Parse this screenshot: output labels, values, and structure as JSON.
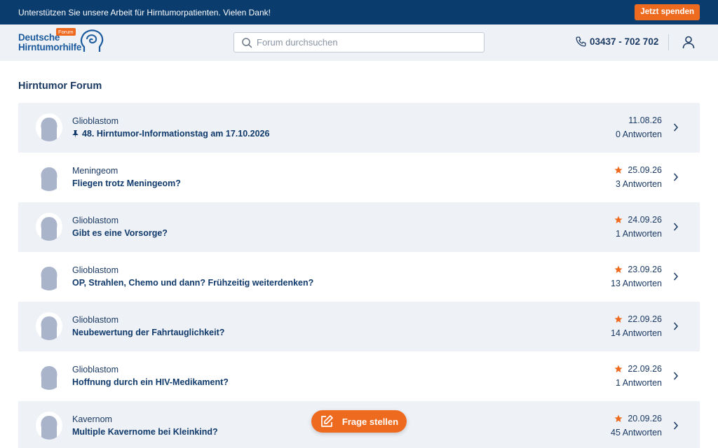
{
  "topbar": {
    "message": "Unterstützen Sie unsere Arbeit für Hirntumorpatienten. Vielen Dank!",
    "donate_label": "Jetzt spenden"
  },
  "header": {
    "logo_line1": "Deutsche",
    "logo_line2": "Hirntumorhilfe",
    "logo_badge": "Forum",
    "search_placeholder": "Forum durchsuchen",
    "phone": "03437 - 702 702"
  },
  "page": {
    "title": "Hirntumor Forum"
  },
  "threads": [
    {
      "category": "Glioblastom",
      "title": "48. Hirntumor-Informationstag am 17.10.2026",
      "date": "11.08.26",
      "replies": "0 Antworten",
      "pinned": true,
      "starred": false
    },
    {
      "category": "Meningeom",
      "title": "Fliegen trotz Meningeom?",
      "date": "25.09.26",
      "replies": "3 Antworten",
      "pinned": false,
      "starred": true
    },
    {
      "category": "Glioblastom",
      "title": "Gibt es eine Vorsorge?",
      "date": "24.09.26",
      "replies": "1 Antworten",
      "pinned": false,
      "starred": true
    },
    {
      "category": "Glioblastom",
      "title": "OP, Strahlen, Chemo und dann? Frühzeitig weiterdenken?",
      "date": "23.09.26",
      "replies": "13 Antworten",
      "pinned": false,
      "starred": true
    },
    {
      "category": "Glioblastom",
      "title": "Neubewertung der Fahrtauglichkeit?",
      "date": "22.09.26",
      "replies": "14 Antworten",
      "pinned": false,
      "starred": true
    },
    {
      "category": "Glioblastom",
      "title": "Hoffnung durch ein HIV-Medikament?",
      "date": "22.09.26",
      "replies": "1 Antworten",
      "pinned": false,
      "starred": true
    },
    {
      "category": "Kavernom",
      "title": "Multiple Kavernome bei Kleinkind?",
      "date": "20.09.26",
      "replies": "45 Antworten",
      "pinned": false,
      "starred": true
    }
  ],
  "fab": {
    "label": "Frage stellen"
  },
  "colors": {
    "navy": "#0a3c6e",
    "accent": "#ee6a1f",
    "row_alt": "#eef1f6",
    "text": "#1b3a63"
  }
}
